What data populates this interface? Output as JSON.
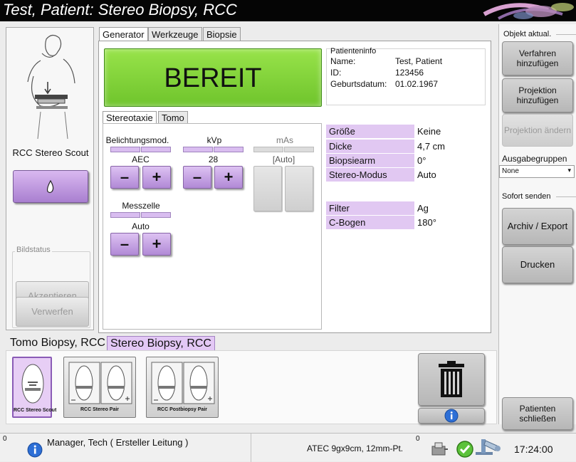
{
  "title": "Test, Patient:  Stereo Biopsy, RCC",
  "left_panel": {
    "view_label": "RCC Stereo Scout",
    "image_status_label": "Bildstatus",
    "accept_label": "Akzeptieren",
    "reject_label": "Verwerfen"
  },
  "tabs": {
    "generator": "Generator",
    "tools": "Werkzeuge",
    "biopsy": "Biopsie"
  },
  "status_display": "BEREIT",
  "patient_info": {
    "heading": "Patienteninfo",
    "name_label": "Name:",
    "name_value": "Test, Patient",
    "id_label": "ID:",
    "id_value": "123456",
    "dob_label": "Geburtsdatum:",
    "dob_value": "01.02.1967"
  },
  "subtabs": {
    "stereo": "Stereotaxie",
    "tomo": "Tomo"
  },
  "controls": {
    "exposure_mode_label": "Belichtungsmod.",
    "exposure_mode_value": "AEC",
    "kvp_label": "kVp",
    "kvp_value": "28",
    "mas_label": "mAs",
    "mas_value": "[Auto]",
    "sensor_label": "Messzelle",
    "sensor_value": "Auto",
    "minus": "–",
    "plus": "+"
  },
  "properties": [
    {
      "name": "Größe",
      "value": "Keine"
    },
    {
      "name": "Dicke",
      "value": "4,7 cm"
    },
    {
      "name": "Biopsiearm",
      "value": "0°"
    },
    {
      "name": "Stereo-Modus",
      "value": "Auto"
    },
    {
      "name": "Filter",
      "value": "Ag"
    },
    {
      "name": "C-Bogen",
      "value": "180°"
    }
  ],
  "right_panel": {
    "update_object_label": "Objekt aktual.",
    "add_procedure": "Verfahren hinzufügen",
    "add_view": "Projektion hinzufügen",
    "edit_view": "Projektion ändern",
    "output_groups_label": "Ausgabegruppen",
    "output_groups_selected": "None",
    "send_now_label": "Sofort senden",
    "archive_export": "Archiv / Export",
    "print": "Drucken",
    "close_patient": "Patienten schließen"
  },
  "procedures": [
    "Tomo Biopsy, RCC",
    "Stereo Biopsy, RCC"
  ],
  "thumbnails": [
    "RCC Stereo Scout",
    "RCC Stereo Pair",
    "RCC Postbiopsy Pair"
  ],
  "statusbar": {
    "alarm_count": "0",
    "user": "Manager, Tech ( Ersteller Leitung )",
    "paddle": "ATEC 9gx9cm, 12mm-Pt.",
    "queue_count": "0",
    "time": "17:24:00"
  },
  "colors": {
    "ready_green": "#7fd33a",
    "accent_purple": "#c9a6e6",
    "title_bar": "#050505"
  }
}
